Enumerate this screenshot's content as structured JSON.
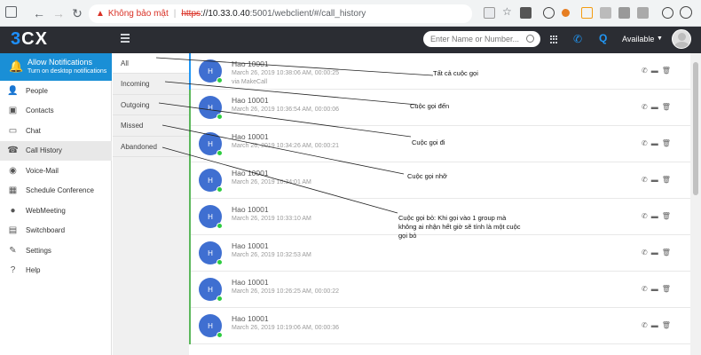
{
  "browser": {
    "warning": "Không bảo mật",
    "divider": "|",
    "scheme": "https",
    "host": "://10.33.0.40",
    "path": ":5001/webclient/#/call_history"
  },
  "header": {
    "logo_num": "3",
    "logo_text": "CX",
    "search_placeholder": "Enter Name or Number...",
    "q_label": "Q",
    "status": "Available"
  },
  "notification": {
    "title": "Allow Notifications",
    "subtitle": "Turn on desktop notifications"
  },
  "sidebar": {
    "items": [
      {
        "label": "People",
        "icon": "person-icon"
      },
      {
        "label": "Contacts",
        "icon": "contacts-icon"
      },
      {
        "label": "Chat",
        "icon": "chat-icon"
      },
      {
        "label": "Call History",
        "icon": "call-history-icon"
      },
      {
        "label": "Voice-Mail",
        "icon": "voicemail-icon"
      },
      {
        "label": "Schedule Conference",
        "icon": "calendar-icon"
      },
      {
        "label": "WebMeeting",
        "icon": "webmeeting-icon"
      },
      {
        "label": "Switchboard",
        "icon": "switchboard-icon"
      },
      {
        "label": "Settings",
        "icon": "wrench-icon"
      },
      {
        "label": "Help",
        "icon": "help-icon"
      }
    ]
  },
  "filters": [
    "All",
    "Incoming",
    "Outgoing",
    "Missed",
    "Abandoned"
  ],
  "calls": [
    {
      "initial": "H",
      "name": "Hao 10001",
      "time": "March 26, 2019 10:38:06 AM, 00:00:25",
      "via": "via MakeCall",
      "type": "outgoing"
    },
    {
      "initial": "H",
      "name": "Hao 10001",
      "time": "March 26, 2019 10:36:54 AM, 00:00:06",
      "via": "",
      "type": "incoming"
    },
    {
      "initial": "H",
      "name": "Hao 10001",
      "time": "March 26, 2019 10:34:26 AM, 00:00:21",
      "via": "",
      "type": "incoming"
    },
    {
      "initial": "H",
      "name": "Hao 10001",
      "time": "March 26, 2019 10:34:01 AM",
      "via": "",
      "type": "incoming"
    },
    {
      "initial": "H",
      "name": "Hao 10001",
      "time": "March 26, 2019 10:33:10 AM",
      "via": "",
      "type": "incoming"
    },
    {
      "initial": "H",
      "name": "Hao 10001",
      "time": "March 26, 2019 10:32:53 AM",
      "via": "",
      "type": "incoming"
    },
    {
      "initial": "H",
      "name": "Hao 10001",
      "time": "March 26, 2019 10:26:25 AM, 00:00:22",
      "via": "",
      "type": "incoming"
    },
    {
      "initial": "H",
      "name": "Hao 10001",
      "time": "March 26, 2019 10:19:06 AM, 00:00:36",
      "via": "",
      "type": "incoming"
    }
  ],
  "annotations": [
    {
      "text": "Tất cả cuộc gọi"
    },
    {
      "text": "Cuộc gọi đến"
    },
    {
      "text": "Cuộc gọi đi"
    },
    {
      "text": "Cuộc gọi nhỡ"
    },
    {
      "text": "Cuộc gọi bỏ: Khi gọi vào 1 group mà không ai nhận hết giờ sẽ tính là một cuộc gọi bỏ"
    }
  ],
  "colors": {
    "accent": "#1a8fd6",
    "header": "#2b2d33",
    "avatar": "#3f6fd1",
    "online": "#2ecc40",
    "outgoing_bar": "#2196f3",
    "incoming_bar": "#5cb85c"
  }
}
